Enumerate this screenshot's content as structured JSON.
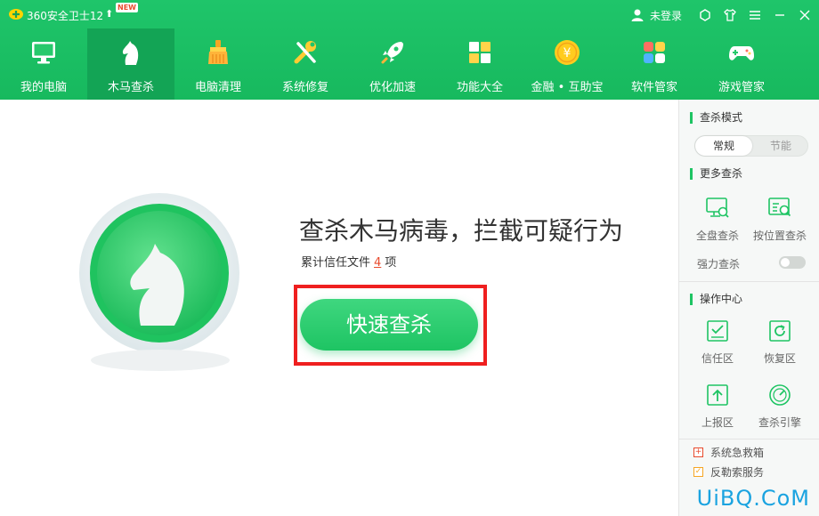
{
  "titlebar": {
    "app_title": "360安全卫士12",
    "new_badge": "NEW",
    "login_text": "未登录"
  },
  "nav": {
    "items": [
      {
        "label": "我的电脑",
        "icon": "monitor-icon"
      },
      {
        "label": "木马查杀",
        "icon": "horse-icon",
        "active": true
      },
      {
        "label": "电脑清理",
        "icon": "broom-icon"
      },
      {
        "label": "系统修复",
        "icon": "wrench-icon"
      },
      {
        "label": "优化加速",
        "icon": "rocket-icon"
      },
      {
        "label": "功能大全",
        "icon": "grid-icon"
      },
      {
        "label": "金融 • 互助宝",
        "icon": "coin-icon"
      },
      {
        "label": "软件管家",
        "icon": "apps-icon"
      },
      {
        "label": "游戏管家",
        "icon": "gamepad-icon"
      }
    ]
  },
  "main": {
    "headline": "查杀木马病毒，拦截可疑行为",
    "trust_prefix": "累计信任文件",
    "trust_count": "4",
    "trust_suffix": "项",
    "scan_button": "快速查杀"
  },
  "sidebar": {
    "mode_title": "查杀模式",
    "mode_normal": "常规",
    "mode_eco": "节能",
    "more_title": "更多查杀",
    "full_scan": "全盘查杀",
    "custom_scan": "按位置查杀",
    "strong_scan": "强力查杀",
    "ops_title": "操作中心",
    "trust_zone": "信任区",
    "restore_zone": "恢复区",
    "report_zone": "上报区",
    "engine": "查杀引擎",
    "rescue": "系统急救箱",
    "ransom": "反勒索服务"
  },
  "watermark": "UiBQ.CoM",
  "colors": {
    "brand_green": "#1ec463",
    "active_tab": "#13a455",
    "highlight_red": "#ef1f1f"
  }
}
